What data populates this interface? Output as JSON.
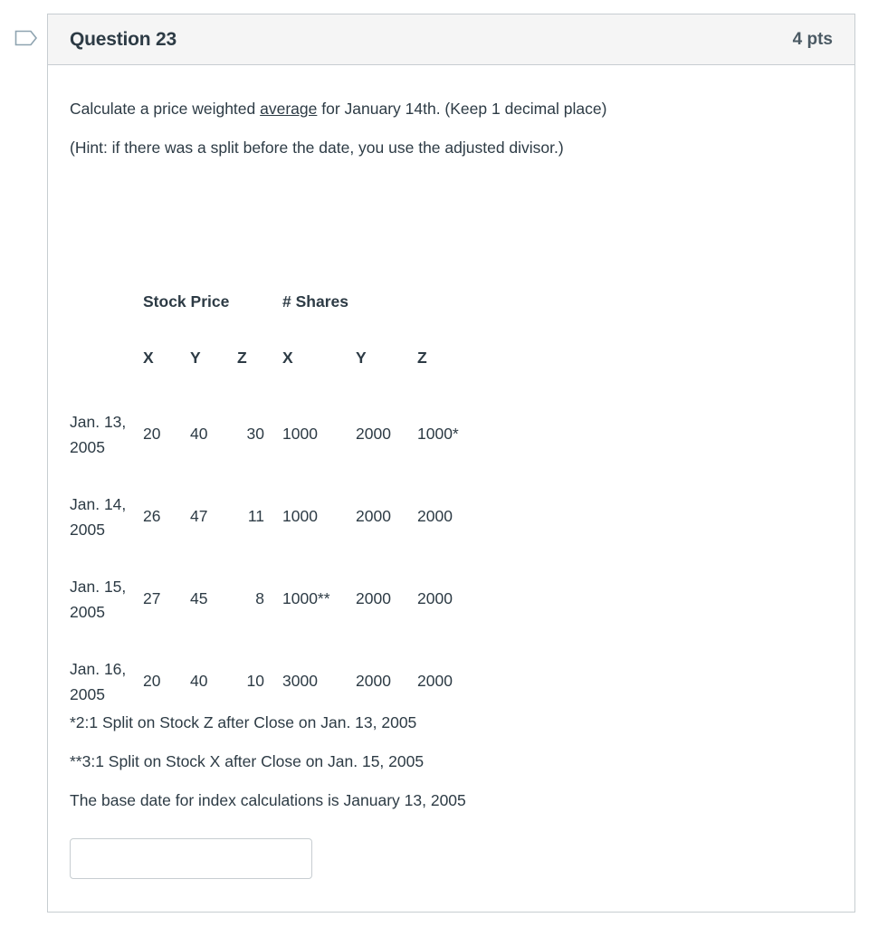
{
  "question": {
    "title": "Question 23",
    "points": "4 pts",
    "prompt_before": "Calculate a price weighted ",
    "prompt_underlined": "average",
    "prompt_after": " for January 14th. (Keep 1 decimal place)",
    "hint": "(Hint: if there was a split before the date, you use the adjusted divisor.)",
    "table": {
      "group_headers": {
        "price": "Stock Price",
        "shares": "# Shares"
      },
      "columns": [
        "X",
        "Y",
        "Z",
        "X",
        "Y",
        "Z"
      ],
      "rows": [
        {
          "date_line1": "Jan. 13,",
          "date_line2": "2005",
          "cells": [
            "20",
            "40",
            "30",
            "1000",
            "2000",
            "1000*"
          ]
        },
        {
          "date_line1": "Jan. 14,",
          "date_line2": "2005",
          "cells": [
            "26",
            "47",
            "11",
            "1000",
            "2000",
            "2000"
          ]
        },
        {
          "date_line1": "Jan. 15,",
          "date_line2": "2005",
          "cells": [
            "27",
            "45",
            "8",
            "1000**",
            "2000",
            "2000"
          ]
        },
        {
          "date_line1": "Jan. 16,",
          "date_line2": "2005",
          "cells": [
            "20",
            "40",
            "10",
            "3000",
            "2000",
            "2000"
          ]
        }
      ]
    },
    "notes": [
      "*2:1 Split on Stock Z after Close on Jan. 13, 2005",
      "**3:1 Split on Stock X after Close on Jan. 15, 2005",
      "The base date for index calculations is January 13, 2005"
    ],
    "answer": {
      "value": "",
      "placeholder": ""
    }
  },
  "colors": {
    "text": "#2d3b45",
    "border": "#c7cdd1",
    "header_bg": "#f5f5f5",
    "bookmark": "#7a8d99"
  },
  "icons": {
    "bookmark": "bookmark-flag-icon"
  }
}
